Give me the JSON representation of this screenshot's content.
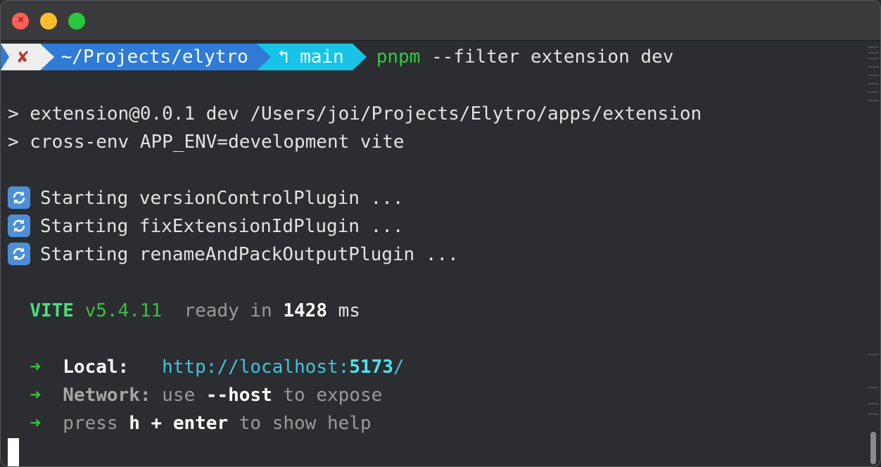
{
  "window": {
    "traffic_lights": [
      "close",
      "minimize",
      "maximize"
    ],
    "close_glyph": "×"
  },
  "prompt": {
    "status": "✘",
    "path": "~/Projects/elytro",
    "branch_icon": "↰",
    "branch": "main",
    "command_bin": "pnpm",
    "command_args": " --filter extension dev"
  },
  "output": {
    "line1": "> extension@0.0.1 dev /Users/joi/Projects/Elytro/apps/extension",
    "line2": "> cross-env APP_ENV=development vite",
    "plugins": [
      "Starting versionControlPlugin ...",
      "Starting fixExtensionIdPlugin ...",
      "Starting renameAndPackOutputPlugin ..."
    ],
    "vite": {
      "name": "VITE",
      "version": "v5.4.11",
      "ready_text": "ready in",
      "ms_value": "1428",
      "ms_unit": "ms"
    },
    "local": {
      "arrow": "➜",
      "label": "Local:",
      "url_prefix": "http://localhost:",
      "port": "5173",
      "url_suffix": "/"
    },
    "network": {
      "arrow": "➜",
      "label": "Network:",
      "use": "use",
      "flag": "--host",
      "rest": "to expose"
    },
    "help": {
      "arrow": "➜",
      "press": "press",
      "keys": "h + enter",
      "rest": "to show help"
    }
  },
  "colors": {
    "background": "#2c2d31",
    "prompt_dir": "#2f7bd6",
    "prompt_git": "#17c4e6",
    "green": "#38c23e",
    "cyan": "#3fc4dd"
  }
}
